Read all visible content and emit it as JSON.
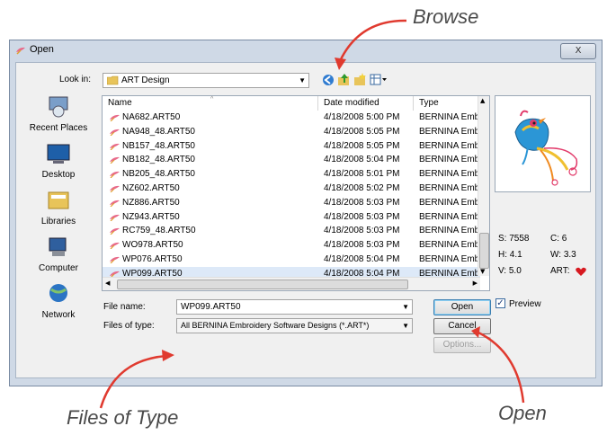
{
  "annotations": {
    "browse": "Browse",
    "files_of_type": "Files of Type",
    "open": "Open"
  },
  "window": {
    "title": "Open",
    "close_symbol": "X"
  },
  "look_in": {
    "label": "Look in:",
    "value": "ART Design"
  },
  "places": [
    {
      "label": "Recent Places",
      "icon": "recent-places-icon"
    },
    {
      "label": "Desktop",
      "icon": "desktop-icon"
    },
    {
      "label": "Libraries",
      "icon": "libraries-icon"
    },
    {
      "label": "Computer",
      "icon": "computer-icon"
    },
    {
      "label": "Network",
      "icon": "network-icon"
    }
  ],
  "columns": {
    "name": "Name",
    "date": "Date modified",
    "type": "Type"
  },
  "files": [
    {
      "name": "NA682.ART50",
      "date": "4/18/2008 5:00 PM",
      "type": "BERNINA Embro"
    },
    {
      "name": "NA948_48.ART50",
      "date": "4/18/2008 5:05 PM",
      "type": "BERNINA Embro"
    },
    {
      "name": "NB157_48.ART50",
      "date": "4/18/2008 5:05 PM",
      "type": "BERNINA Embro"
    },
    {
      "name": "NB182_48.ART50",
      "date": "4/18/2008 5:04 PM",
      "type": "BERNINA Embro"
    },
    {
      "name": "NB205_48.ART50",
      "date": "4/18/2008 5:01 PM",
      "type": "BERNINA Embro"
    },
    {
      "name": "NZ602.ART50",
      "date": "4/18/2008 5:02 PM",
      "type": "BERNINA Embro"
    },
    {
      "name": "NZ886.ART50",
      "date": "4/18/2008 5:03 PM",
      "type": "BERNINA Embro"
    },
    {
      "name": "NZ943.ART50",
      "date": "4/18/2008 5:03 PM",
      "type": "BERNINA Embro"
    },
    {
      "name": "RC759_48.ART50",
      "date": "4/18/2008 5:03 PM",
      "type": "BERNINA Embro"
    },
    {
      "name": "WO978.ART50",
      "date": "4/18/2008 5:03 PM",
      "type": "BERNINA Embro"
    },
    {
      "name": "WP076.ART50",
      "date": "4/18/2008 5:04 PM",
      "type": "BERNINA Embro"
    },
    {
      "name": "WP099.ART50",
      "date": "4/18/2008 5:04 PM",
      "type": "BERNINA Embro"
    }
  ],
  "selected_file_index": 11,
  "stats": {
    "s": "S: 7558",
    "c": "C: 6",
    "h": "H: 4.1",
    "w": "W: 3.3",
    "v": "V: 5.0",
    "art": "ART:"
  },
  "file_name": {
    "label": "File name:",
    "value": "WP099.ART50"
  },
  "files_of_type": {
    "label": "Files of type:",
    "value": "All BERNINA Embroidery Software Designs (*.ART*)"
  },
  "buttons": {
    "open": "Open",
    "cancel": "Cancel",
    "options": "Options..."
  },
  "preview": {
    "label": "Preview",
    "checked": true
  },
  "colors": {
    "arrow_red": "#e03a2f",
    "heart_red": "#d71920"
  }
}
